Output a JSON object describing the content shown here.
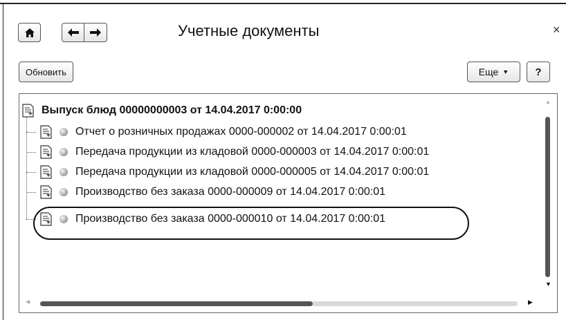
{
  "window": {
    "title": "Учетные документы",
    "close_glyph": "×"
  },
  "nav": {
    "home_icon": "home-icon",
    "back_icon": "arrow-left-icon",
    "forward_icon": "arrow-right-icon"
  },
  "toolbar": {
    "refresh_label": "Обновить",
    "more_label": "Еще",
    "help_label": "?"
  },
  "tree": {
    "root": {
      "label": "Выпуск блюд 00000000003 от 14.04.2017 0:00:00",
      "icon": "document-icon"
    },
    "children": [
      {
        "label": "Отчет о розничных продажах 0000-000002 от 14.04.2017 0:00:01",
        "status": "gray"
      },
      {
        "label": "Передача продукции из кладовой 0000-000003 от 14.04.2017 0:00:01",
        "status": "gray"
      },
      {
        "label": "Передача продукции из кладовой 0000-000005 от 14.04.2017 0:00:01",
        "status": "gray"
      },
      {
        "label": "Производство без заказа 0000-000009 от 14.04.2017 0:00:01",
        "status": "gray"
      },
      {
        "label": "Производство без заказа 0000-000010 от 14.04.2017 0:00:01",
        "status": "gray",
        "highlighted": true
      }
    ]
  }
}
